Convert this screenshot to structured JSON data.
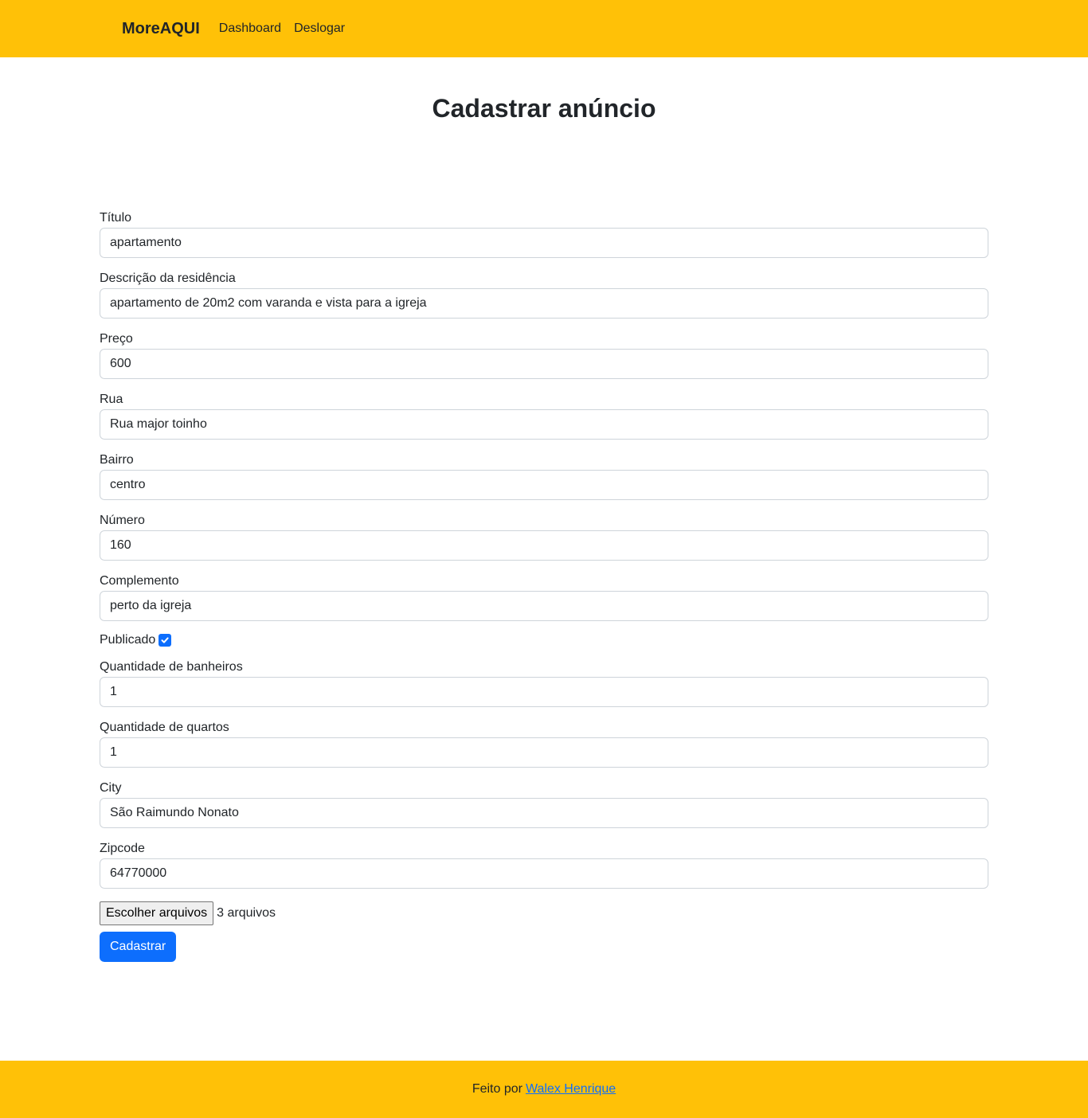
{
  "navbar": {
    "brand": "MoreAQUI",
    "links": [
      "Dashboard",
      "Deslogar"
    ]
  },
  "page": {
    "title": "Cadastrar anúncio"
  },
  "form": {
    "titulo": {
      "label": "Título",
      "value": "apartamento"
    },
    "descricao": {
      "label": "Descrição da residência",
      "value": "apartamento de 20m2 com varanda e vista para a igreja"
    },
    "preco": {
      "label": "Preço",
      "value": "600"
    },
    "rua": {
      "label": "Rua",
      "value": "Rua major toinho"
    },
    "bairro": {
      "label": "Bairro",
      "value": "centro"
    },
    "numero": {
      "label": "Número",
      "value": "160"
    },
    "complemento": {
      "label": "Complemento",
      "value": "perto da igreja"
    },
    "publicado": {
      "label": "Publicado",
      "checked": true
    },
    "banheiros": {
      "label": "Quantidade de banheiros",
      "value": "1"
    },
    "quartos": {
      "label": "Quantidade de quartos",
      "value": "1"
    },
    "city": {
      "label": "City",
      "value": "São Raimundo Nonato"
    },
    "zipcode": {
      "label": "Zipcode",
      "value": "64770000"
    },
    "file": {
      "button_label": "Escolher arquivos",
      "status": "3 arquivos"
    },
    "submit_label": "Cadastrar"
  },
  "footer": {
    "text": "Feito por",
    "author_link": "Walex Henrique"
  },
  "colors": {
    "brand_yellow": "#ffc107",
    "primary_blue": "#0d6efd"
  },
  "icons": {
    "checkbox": "check-icon"
  }
}
